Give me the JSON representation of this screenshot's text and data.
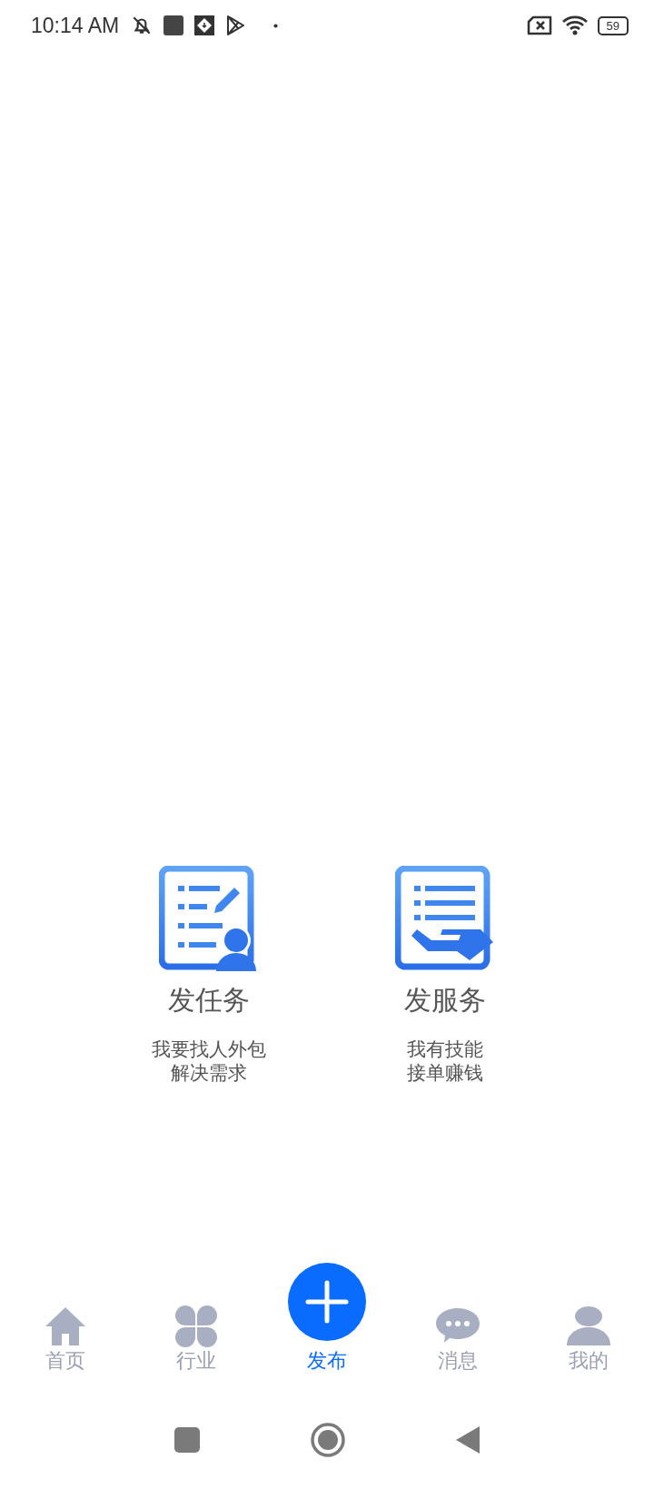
{
  "status_bar": {
    "time": "10:14 AM",
    "battery": "59"
  },
  "options": [
    {
      "kind": "task",
      "title": "发任务",
      "subtitle": [
        "我要找人外包",
        "解决需求"
      ]
    },
    {
      "kind": "service",
      "title": "发服务",
      "subtitle": [
        "我有技能",
        "接单赚钱"
      ]
    }
  ],
  "tabs": [
    {
      "kind": "home",
      "label": "首页",
      "selected": false
    },
    {
      "kind": "industry",
      "label": "行业",
      "selected": false
    },
    {
      "kind": "publish",
      "label": "发布",
      "selected": true
    },
    {
      "kind": "messages",
      "label": "消息",
      "selected": false
    },
    {
      "kind": "profile",
      "label": "我的",
      "selected": false
    }
  ]
}
